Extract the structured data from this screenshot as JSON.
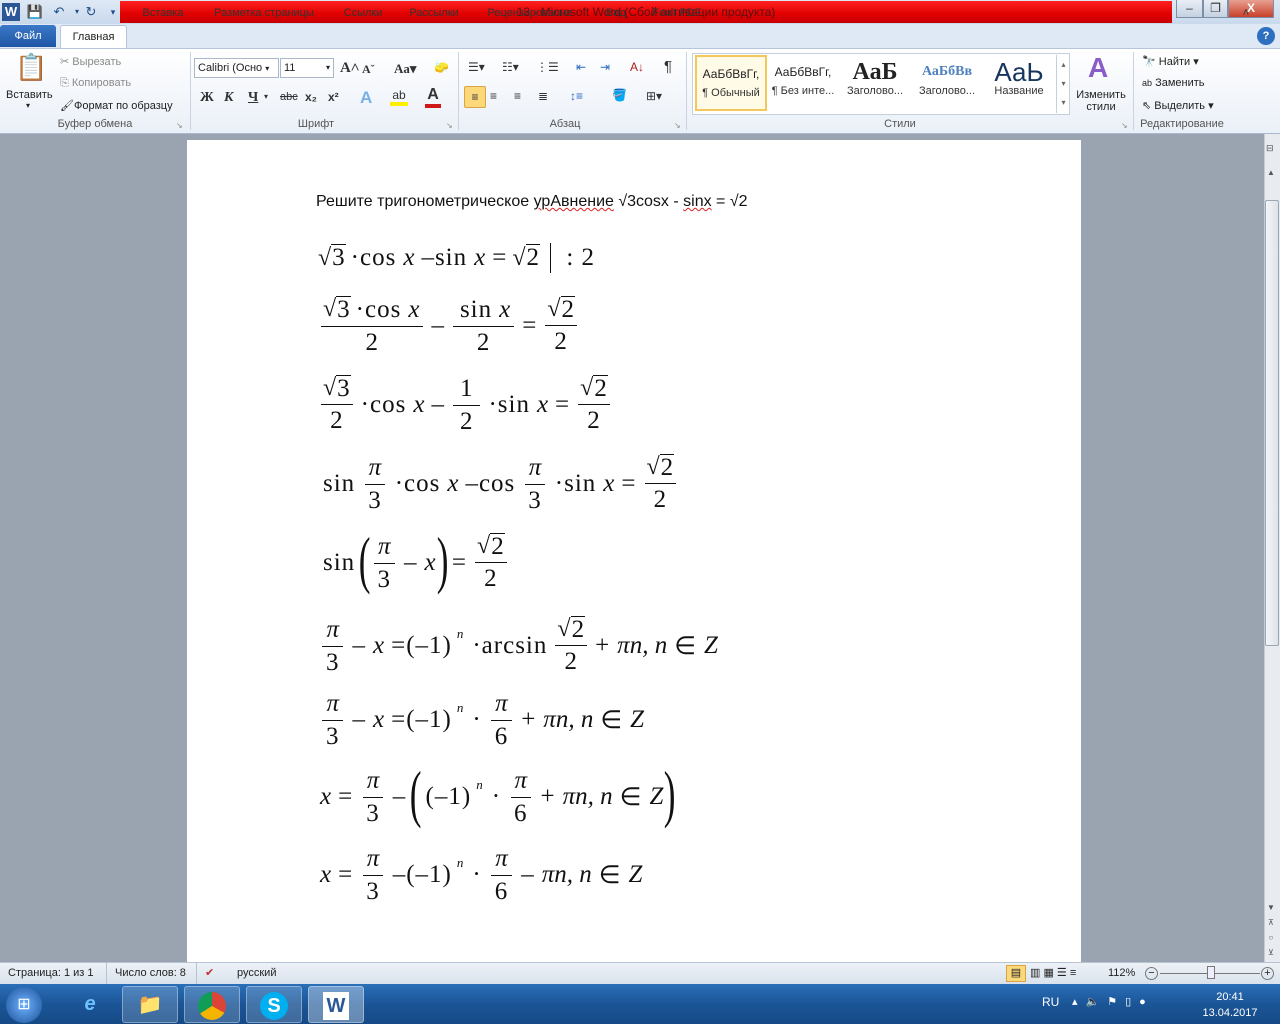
{
  "window": {
    "title": "13 - Microsoft Word (Сбой активации продукта)"
  },
  "tabs": [
    "Файл",
    "Главная",
    "Вставка",
    "Разметка страницы",
    "Ссылки",
    "Рассылки",
    "Рецензирование",
    "Вид",
    "Foxit PDF"
  ],
  "clipboard": {
    "paste": "Вставить",
    "cut": "Вырезать",
    "copy": "Копировать",
    "format_painter": "Формат по образцу",
    "label": "Буфер обмена"
  },
  "font": {
    "name": "Calibri (Осно",
    "size": "11",
    "label": "Шрифт",
    "bold": "Ж",
    "italic": "К",
    "underline": "Ч",
    "strike": "abc",
    "sub": "x₂",
    "sup": "x²",
    "grow": "A",
    "shrink": "A",
    "case": "Aa"
  },
  "paragraph": {
    "label": "Абзац"
  },
  "styles": {
    "label": "Стили",
    "items": [
      {
        "preview": "АаБбВвГг,",
        "name": "¶ Обычный"
      },
      {
        "preview": "АаБбВвГг,",
        "name": "¶ Без инте..."
      },
      {
        "preview": "АаБ",
        "name": "Заголово..."
      },
      {
        "preview": "АаБбВв",
        "name": "Заголово..."
      },
      {
        "preview": "АаЬ",
        "name": "Название"
      }
    ],
    "change": "Изменить стили"
  },
  "editing": {
    "label": "Редактирование",
    "find": "Найти",
    "replace": "Заменить",
    "select": "Выделить"
  },
  "document": {
    "heading_parts": [
      "Решите тригонометрическое ",
      "урАвнение",
      " √3cosx - ",
      "sinx",
      " = √2"
    ],
    "equations": [
      [
        {
          "sqrt": "3"
        },
        "·cos",
        {
          "i": "x"
        },
        "–sin",
        {
          "i": "x"
        },
        "=",
        {
          "sqrt": "2"
        },
        {
          "bar": true
        },
        ": 2"
      ],
      [
        {
          "frac": [
            [
              {
                "sqrt": "3"
              },
              "·cos",
              {
                "i": "x"
              }
            ],
            [
              "2"
            ]
          ]
        },
        "–",
        {
          "frac": [
            [
              "sin",
              {
                "i": "x"
              }
            ],
            [
              "2"
            ]
          ]
        },
        "=",
        {
          "frac": [
            [
              {
                "sqrt": "2"
              }
            ],
            [
              "2"
            ]
          ]
        }
      ],
      [
        {
          "frac": [
            [
              {
                "sqrt": "3"
              }
            ],
            [
              "2"
            ]
          ]
        },
        "·cos",
        {
          "i": "x"
        },
        "–",
        {
          "frac": [
            [
              "1"
            ],
            [
              "2"
            ]
          ]
        },
        "·sin",
        {
          "i": "x"
        },
        "=",
        {
          "frac": [
            [
              {
                "sqrt": "2"
              }
            ],
            [
              "2"
            ]
          ]
        }
      ],
      [
        "sin",
        {
          "frac": [
            [
              {
                "i": "π"
              }
            ],
            [
              "3"
            ]
          ]
        },
        "·cos",
        {
          "i": "x"
        },
        "–cos",
        {
          "frac": [
            [
              {
                "i": "π"
              }
            ],
            [
              "3"
            ]
          ]
        },
        "·sin",
        {
          "i": "x"
        },
        "=",
        {
          "frac": [
            [
              {
                "sqrt": "2"
              }
            ],
            [
              "2"
            ]
          ]
        }
      ],
      [
        "sin",
        {
          "big": "("
        },
        {
          "frac": [
            [
              {
                "i": "π"
              }
            ],
            [
              "3"
            ]
          ]
        },
        "–",
        {
          "i": "x"
        },
        {
          "big": ")"
        },
        "=",
        {
          "frac": [
            [
              {
                "sqrt": "2"
              }
            ],
            [
              "2"
            ]
          ]
        }
      ],
      [
        {
          "frac": [
            [
              {
                "i": "π"
              }
            ],
            [
              "3"
            ]
          ]
        },
        "–",
        {
          "i": "x"
        },
        "=(–1)",
        {
          "sup": "n"
        },
        "·arcsin",
        {
          "frac": [
            [
              {
                "sqrt": "2"
              }
            ],
            [
              "2"
            ]
          ]
        },
        "+",
        {
          "i": "πn, n"
        },
        "∈",
        {
          "i": "Z"
        }
      ],
      [
        {
          "frac": [
            [
              {
                "i": "π"
              }
            ],
            [
              "3"
            ]
          ]
        },
        "–",
        {
          "i": "x"
        },
        "=(–1)",
        {
          "sup": "n"
        },
        "·",
        {
          "frac": [
            [
              {
                "i": "π"
              }
            ],
            [
              "6"
            ]
          ]
        },
        "+",
        {
          "i": "πn, n"
        },
        "∈",
        {
          "i": "Z"
        }
      ],
      [
        {
          "i": "x"
        },
        "=",
        {
          "frac": [
            [
              {
                "i": "π"
              }
            ],
            [
              "3"
            ]
          ]
        },
        "–",
        {
          "big": "("
        },
        "(–1)",
        {
          "sup": "n"
        },
        "·",
        {
          "frac": [
            [
              {
                "i": "π"
              }
            ],
            [
              "6"
            ]
          ]
        },
        "+",
        {
          "i": "πn, n"
        },
        "∈",
        {
          "i": "Z"
        },
        {
          "big": ")"
        }
      ],
      [
        {
          "i": "x"
        },
        "=",
        {
          "frac": [
            [
              {
                "i": "π"
              }
            ],
            [
              "3"
            ]
          ]
        },
        "–(–1)",
        {
          "sup": "n"
        },
        "·",
        {
          "frac": [
            [
              {
                "i": "π"
              }
            ],
            [
              "6"
            ]
          ]
        },
        "–",
        {
          "i": "πn, n"
        },
        "∈",
        {
          "i": "Z"
        }
      ]
    ]
  },
  "status": {
    "page": "Страница: 1 из 1",
    "words": "Число слов: 8",
    "language": "русский",
    "zoom": "112%",
    "zoom_percent": 112
  },
  "taskbar": {
    "lang": "RU",
    "time": "20:41",
    "date": "13.04.2017"
  },
  "colors": {
    "title_red": "#e00000",
    "file_tab": "#2a67b5",
    "taskbar": "#1b5597"
  }
}
